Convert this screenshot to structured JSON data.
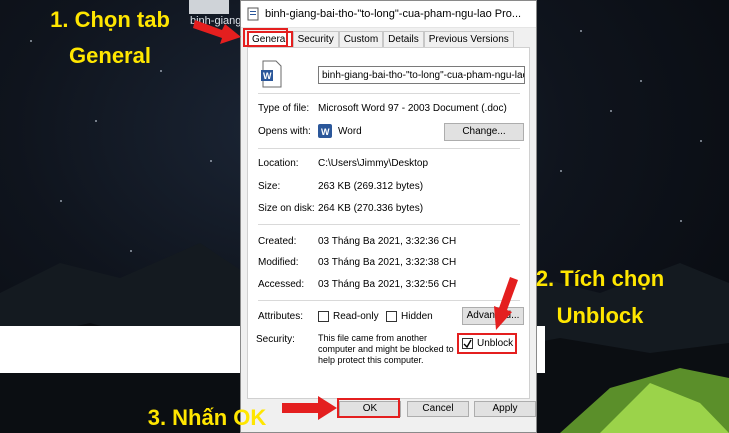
{
  "desktop": {
    "icon_label": "binh-giang"
  },
  "window": {
    "title": "binh-giang-bai-tho-\"to-long\"-cua-pham-ngu-lao Pro..."
  },
  "tabs": [
    "General",
    "Security",
    "Custom",
    "Details",
    "Previous Versions"
  ],
  "general": {
    "filename": "binh-giang-bai-tho-\"to-long\"-cua-pham-ngu-lao",
    "type_label": "Type of file:",
    "type_value": "Microsoft Word 97 - 2003 Document (.doc)",
    "opens_label": "Opens with:",
    "opens_value": "Word",
    "change_button": "Change...",
    "location_label": "Location:",
    "location_value": "C:\\Users\\Jimmy\\Desktop",
    "size_label": "Size:",
    "size_value": "263 KB (269.312 bytes)",
    "disk_label": "Size on disk:",
    "disk_value": "264 KB (270.336 bytes)",
    "created_label": "Created:",
    "created_value": "03 Tháng Ba 2021, 3:32:36 CH",
    "modified_label": "Modified:",
    "modified_value": "03 Tháng Ba 2021, 3:32:38 CH",
    "accessed_label": "Accessed:",
    "accessed_value": "03 Tháng Ba 2021, 3:32:56 CH",
    "attributes_label": "Attributes:",
    "readonly_label": "Read-only",
    "hidden_label": "Hidden",
    "advanced_button": "Advanced...",
    "security_label": "Security:",
    "security_text": "This file came from another computer and might be blocked to help protect this computer.",
    "unblock_label": "Unblock"
  },
  "buttons": {
    "ok": "OK",
    "cancel": "Cancel",
    "apply": "Apply"
  },
  "annotations": {
    "step1_line1": "1. Chọn tab",
    "step1_line2": "General",
    "step2_line1": "2. Tích chọn",
    "step2_line2": "Unblock",
    "step3": "3. Nhấn OK"
  },
  "colors": {
    "highlight": "#e41f1f",
    "annotation_text": "#ffe600"
  }
}
